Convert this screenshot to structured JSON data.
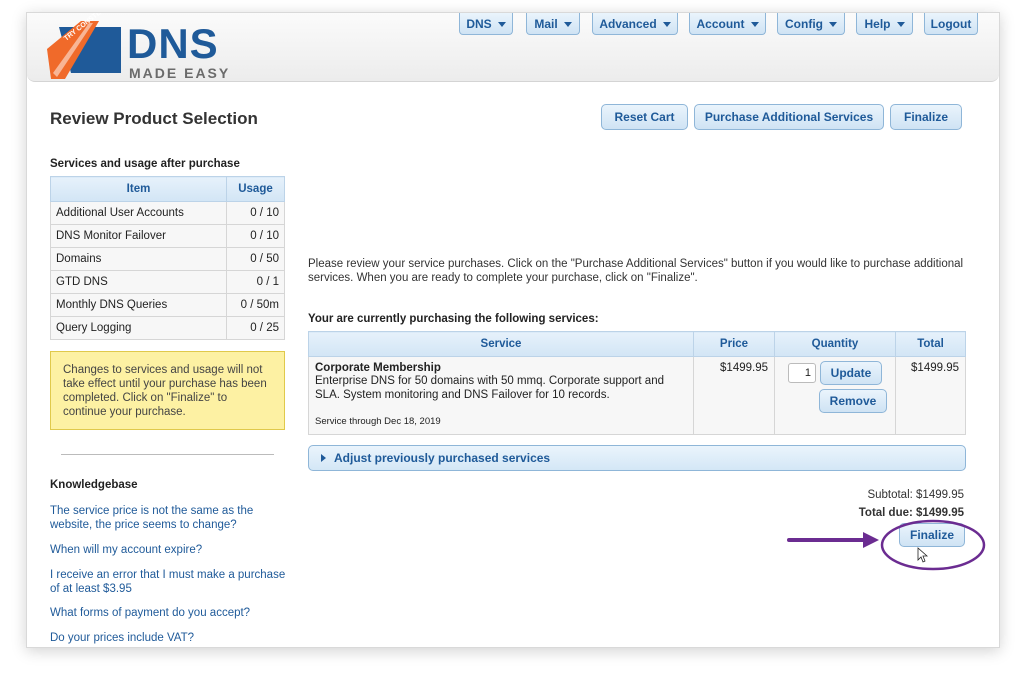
{
  "brand": {
    "name": "DNS",
    "sub": "MADE EASY",
    "tag": "TRY CONSTELLIX!"
  },
  "nav": [
    {
      "label": "DNS"
    },
    {
      "label": "Mail"
    },
    {
      "label": "Advanced"
    },
    {
      "label": "Account"
    },
    {
      "label": "Config"
    },
    {
      "label": "Help"
    },
    {
      "label": "Logout"
    }
  ],
  "page": {
    "title": "Review Product Selection"
  },
  "toolbar": {
    "reset": "Reset Cart",
    "purchase_more": "Purchase Additional Services",
    "finalize": "Finalize"
  },
  "sidebar": {
    "heading": "Services and usage after purchase",
    "col_item": "Item",
    "col_usage": "Usage",
    "rows": [
      {
        "item": "Additional User Accounts",
        "usage": "0 / 10"
      },
      {
        "item": "DNS Monitor Failover",
        "usage": "0 / 10"
      },
      {
        "item": "Domains",
        "usage": "0 / 50"
      },
      {
        "item": "GTD DNS",
        "usage": "0 / 1"
      },
      {
        "item": "Monthly DNS Queries",
        "usage": "0 / 50m"
      },
      {
        "item": "Query Logging",
        "usage": "0 / 25"
      }
    ],
    "notice": "Changes to services and usage will not take effect until your purchase has been completed. Click on \"Finalize\" to continue your purchase."
  },
  "knowledgebase": {
    "heading": "Knowledgebase",
    "links": [
      "The service price is not the same as the website, the price seems to change?",
      "When will my account expire?",
      "I receive an error that I must make a purchase of at least $3.95",
      "What forms of payment do you accept?",
      "Do your prices include VAT?"
    ]
  },
  "main": {
    "intro": "Please review your service purchases. Click on the \"Purchase Additional Services\" button if you would like to purchase additional services. When you are ready to complete your purchase, click on \"Finalize\".",
    "purchasing_heading": "Your are currently purchasing the following services:",
    "cols": {
      "service": "Service",
      "price": "Price",
      "quantity": "Quantity",
      "total": "Total"
    },
    "item": {
      "name": "Corporate Membership",
      "desc": "Enterprise DNS for 50 domains with 50 mmq. Corporate support and SLA. System monitoring and DNS Failover for 10 records.",
      "through": "Service through Dec 18, 2019",
      "price": "$1499.95",
      "quantity": "1",
      "total": "$1499.95",
      "update": "Update",
      "remove": "Remove"
    },
    "adjust": "Adjust previously purchased services",
    "subtotal": "Subtotal: $1499.95",
    "total_due": "Total due: $1499.95",
    "finalize": "Finalize"
  },
  "colors": {
    "accent": "#1f5a99",
    "highlight": "#6b2c91",
    "notice": "#fdf1a3"
  }
}
